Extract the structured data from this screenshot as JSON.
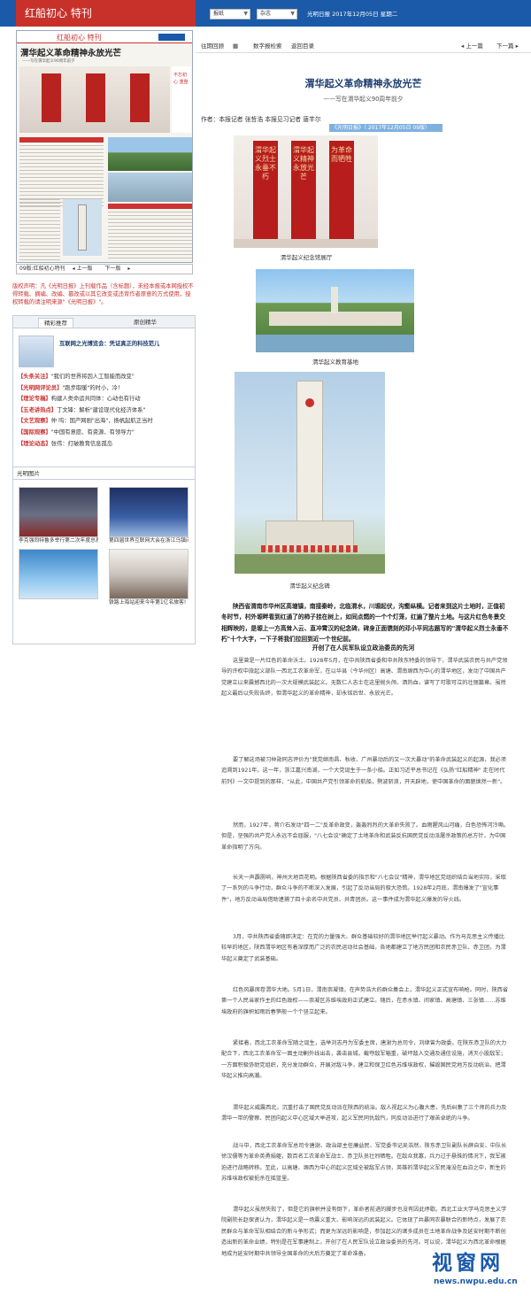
{
  "topbar": {
    "banner_text": "红船初心 特刊",
    "select_section": "报纸",
    "select_type": "杂志",
    "date_text": "光明日报 2017年12月05日 星期二"
  },
  "thumbnail": {
    "headline": "渭华起义革命精神永放光芒",
    "subline": "——写在渭华起义90周年前夕",
    "side_text": "不忘初心 重整"
  },
  "issue_bar": {
    "page_label": "09版:红船初心特刊",
    "prev": "上一版",
    "next": "下一版"
  },
  "notice": "版权声明：凡《光明日报》上刊载作品（含标题），未经本报或本网授权不得转载、摘编、改编、篡改或以其它改变或违背作者原意的方式使用，授权转载的请注明来源\"《光明日报》\"。",
  "tabs": {
    "tab1": "精彩推荐",
    "tab2": "原创精华",
    "featured_title": "互联网之光博览会：凭证真正的科技范儿",
    "items": [
      {
        "tag": "【头条关注】",
        "text": "\"我们的世界将因人工智能而改变\""
      },
      {
        "tag": "【光明网评论员】",
        "text": "\"跑步取暖\"的时小，冷！"
      },
      {
        "tag": "【理论专稿】",
        "text": "构建人类命运共同体：心动也有行动"
      },
      {
        "tag": "【五老讲热点】",
        "text": "丁文锋：解析\"建设现代化经济体系\""
      },
      {
        "tag": "【文艺观察】",
        "text": "仲 呜：国产网剧\"出海\"，扬帆起航正当时"
      },
      {
        "tag": "【国际观察】",
        "text": "\"中国有意愿、有资源、有领导力\""
      },
      {
        "tag": "【理论动态】",
        "text": "张伟：打破教育信息孤岛"
      }
    ]
  },
  "photos": {
    "heading": "光明图片",
    "items": [
      {
        "caption": "李克强同特鲁多举行第二次年度总理"
      },
      {
        "caption": "第四届世界互联网大会在浙江乌镇闭"
      },
      {
        "caption": ""
      },
      {
        "caption": "铁路上海站迎来今年第1亿名旅客!"
      }
    ]
  },
  "toolbar": {
    "prev_issue": "往期回顾",
    "digital_search": "数字报检索",
    "back_home": "返回目录",
    "prev_page": "上一篇",
    "next_page": "下一篇"
  },
  "article": {
    "title": "渭华起义革命精神永放光芒",
    "subtitle": "——写在渭华起义90周年前夕",
    "byline": "作者：本报记者 张哲浩 本报见习记者 唐芊尔",
    "source": "《光明日报》（ 2017年12月05日 09版）",
    "figures": [
      {
        "caption": "渭华起义纪念馆展厅",
        "boards": [
          "渭华起义烈士永垂不朽",
          "渭华起义精神永放光芒",
          "为革命而牺牲"
        ]
      },
      {
        "caption": "渭华起义教育基地"
      },
      {
        "caption": "渭华起义纪念碑"
      }
    ],
    "lead": "陕西省渭南市华州区高塘镇，南接秦岭，北临渭水，川塬起伏，沟壑纵横。记者来到这片土地时，正值初冬时节，村外塬畔看到红通了的柿子挂在树上，如同点燃的一个个灯笼，红遍了整片土地。与这片红色冬景交相辉映的，是塬上一方高耸入云、直冲霄汉的纪念碑，碑身正面镌刻的邓小平同志题写的\"渭华起义烈士永垂不朽\"十个大字，一下子将我们拉回到近一个世纪前。",
    "section": "开创了在人民军队设立政治委员的先河",
    "paragraphs": [
      "这里曾是一片红色的革命沃土。1928年5月，在中共陕西省委和中共陕东特委的领导下，渭华武装农民与共产党领导的许权中旅起义部队一西北工农革命军，在以华县（今华州区）高塘、渭南塬西为中心的渭华地区，发动了中国共产党建立以来震撼西北的一次大规模武装起义。无数仁人志士在这里抛头颅、洒热血，谱写了可歌可泣的壮丽篇章。虽然起义最后以失败告终，但渭华起义的革命精神，却永铭后世、永放光芒。",
      "要了解这场被习仲勋同志评价为\"我党继南昌、秋收、广州暴动后的又一次大暴动\"的革命武装起义的起源，我必须追溯到1921年。这一年，浙江嘉兴南湖，一个大党诞生于一条小船。正如习近平总书记在《弘扬\"红船精神\" 走在时代前列》一文中提到的那样，\"从此，中国共产党引领革命的航船，劈波斩浪，开天辟地，使中国革命的面貌焕然一新\"。",
      "然而，1927年，蒋介石发动\"四一二\"反革命政变，轰轰烈烈的大革命失败了。血雨腥风山河痛，白色恐怖河冷嘶。但是，坚强的共产党人永远不会屈服，\"八七会议\"确定了土地革命和武装反抗国民党反动派屠杀政策的总方针，为中国革命指明了方向。",
      "长天一声霹雳响，神州大地百花明。根据陕西省委的指示和\"八七会议\"精神，渭华地区党组织结合当地实际，采取了一系列的斗争行动，群众斗争的不断深入发展，引起了反动当局的极大恐慌。1928年2月底，渭南爆发了\"宣化事件\"，地方反动当局借助逮捕了四十余名中共党员、共青团员。这一事件成为渭华起义爆发的导火线。",
      "3月，中共陕西省委随即决定：在党的力量强大、群众基础较好的渭华地区举行起义暴动。作为马克思主义传播比较早的地区，陕西渭华地区有着深厚而广泛的农民运动社会基础，各地都建立了地方民团和农民赤卫队、赤卫团，为渭华起义奠定了武装基础。",
      "红色风暴席卷渭华大地。5月1日，渭南崇凝镇，在声势浩大的群众集会上，渭华起义正式宣布响枪。同时，陕西省第一个人民当家作主的红色政权——崇凝区苏维埃政府正式建立。随后，在赤水镇、间家镇、高塘镇、三张镇……苏维埃政府的旗帜如雨后春笋般一个个竖立起来。",
      "紧接着，西北工农革命军随之诞生，选举刘志丹为军委主席，唐澍为总司令，刘继曾为政委。在陕东赤卫队的大力配合下，西北工农革命军一面主动剿外线出击，袭击县城，截夺敌军辎重，破坏敌人交通及通信设施，消灭小股敌军；一方面积极协助党组织，充分发动群众，开展对敌斗争，建立和保卫红色苏维埃政权，摧毁国民党地方反动统治，把渭华起义推向高潮。",
      "渭华起义威震西北，沉重打击了国民党反动派在陕西的统治。敌人视起义为心腹大患，先后纠集了三个师的兵力及渭华一带的警察、民团向起义中心区域大举进攻，起义军民同仇敌忾，同反动派进行了艰苦卓绝的斗争。",
      "战斗中，西北工农革命军总司令唐澍、政治部主任廉益民、军党委书记吴浩然，陕东赤卫队副队长薛自安、中队长徐汉儒等为革命英勇捐躯，数百名工农革命军战士、赤卫队员壮烈牺牲。在敌众我寡，兵力过于悬殊的情况下，我军被迫进行战略转移。至此，以高塘、塬西为中心的起义区域全被敌军占领，英雄的渭华起义军民淹没在血泊之中，新生的苏维埃政权被扼杀在摇篮里。",
      "渭华起义虽然失败了，但是它的旗帜并没有倒下，革命者前进的脚步也没有因此停歇。西北工业大学马克思主义学院副院长赵保贤认为，渭华起义是一场震义重大、影响深远的武装起义。它体现了共暴同农暴联合的新特点，发展了农民群众与革命军队相结合的新斗争形式；而更为深远的影响是，参加起义的诸多成员在土地革命战争及延安时期不断创造出新的革命业绩，特别是在军事建制上，开创了在人民军队设立政治委员的先河。可以说，渭华起义为西北革命根据地成为延安时期中共领导全国革命的大后方奠定了革命准备。"
    ]
  },
  "watermark": {
    "big": "视窗网",
    "url": "news.nwpu.edu.cn"
  }
}
